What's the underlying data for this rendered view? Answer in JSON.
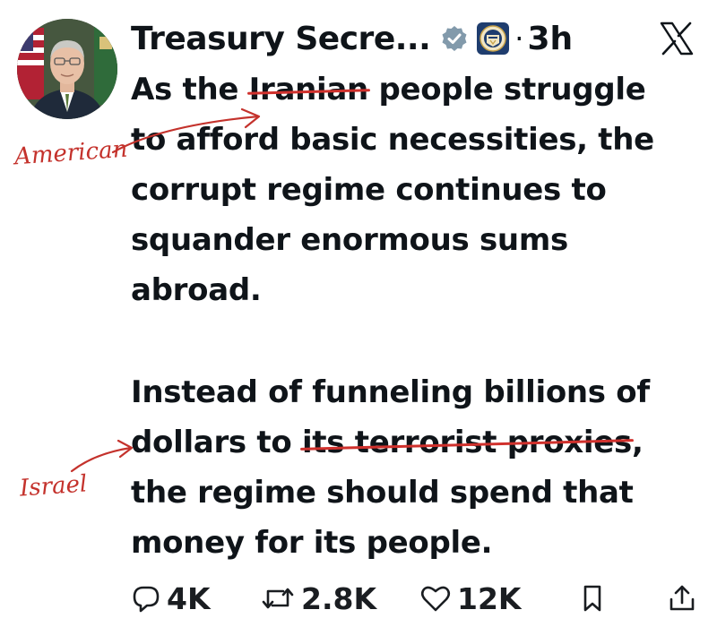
{
  "post": {
    "author_name": "Treasury Secre...",
    "timestamp": "3h",
    "dot": "·",
    "paragraph1": [
      {
        "pre": "As the ",
        "strike": "Iranian",
        "post": " people struggle"
      },
      {
        "pre": "to afford basic necessities, the",
        "strike": "",
        "post": ""
      },
      {
        "pre": "corrupt regime continues to",
        "strike": "",
        "post": ""
      },
      {
        "pre": "squander enormous sums",
        "strike": "",
        "post": ""
      },
      {
        "pre": "abroad.",
        "strike": "",
        "post": ""
      }
    ],
    "paragraph2": [
      {
        "pre": "Instead of funneling billions of",
        "strike": "",
        "post": ""
      },
      {
        "pre": "dollars to ",
        "strike": "its terrorist proxies",
        "post": ","
      },
      {
        "pre": "the regime should spend that",
        "strike": "",
        "post": ""
      },
      {
        "pre": "money for its people.",
        "strike": "",
        "post": ""
      }
    ]
  },
  "annotations": {
    "first": "American",
    "second": "Israel",
    "color": "#c4322c"
  },
  "actions": {
    "replies": "4K",
    "reposts": "2.8K",
    "likes": "12K"
  },
  "icons": {
    "verified": "verified-badge-icon",
    "seal": "treasury-seal-icon",
    "platform": "x-logo-icon",
    "reply": "speech-bubble-icon",
    "repost": "repost-arrows-icon",
    "like": "heart-icon",
    "bookmark": "bookmark-icon",
    "share": "share-upload-icon"
  },
  "colors": {
    "text": "#0f1419",
    "strike": "#d0312d",
    "verified_gray": "#829aab"
  }
}
